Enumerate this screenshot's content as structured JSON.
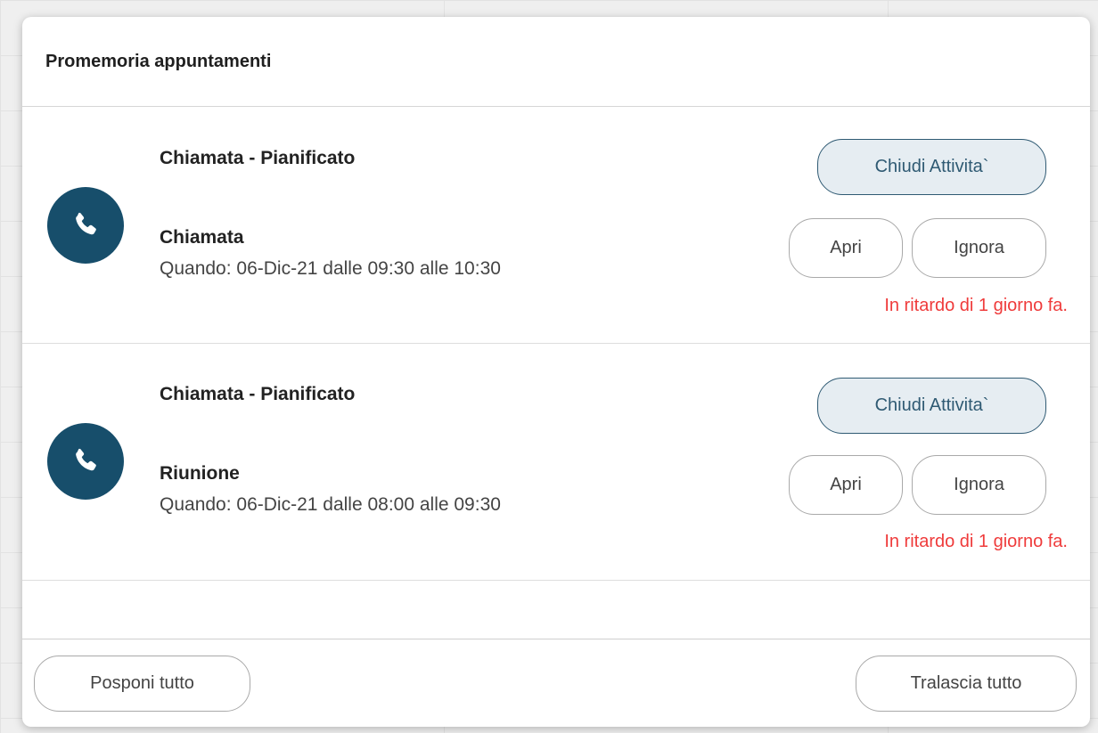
{
  "dialog": {
    "title": "Promemoria appuntamenti"
  },
  "reminders": [
    {
      "title": "Chiamata - Pianificato",
      "subject": "Chiamata",
      "when": "Quando: 06-Dic-21 dalle 09:30 alle 10:30",
      "close_label": "Chiudi Attivita`",
      "open_label": "Apri",
      "ignore_label": "Ignora",
      "status": "In ritardo di 1 giorno fa.",
      "icon": "phone-icon"
    },
    {
      "title": "Chiamata - Pianificato",
      "subject": "Riunione",
      "when": "Quando: 06-Dic-21 dalle 08:00 alle 09:30",
      "close_label": "Chiudi Attivita`",
      "open_label": "Apri",
      "ignore_label": "Ignora",
      "status": "In ritardo di 1 giorno fa.",
      "icon": "phone-icon"
    }
  ],
  "footer": {
    "snooze_all_label": "Posponi tutto",
    "dismiss_all_label": "Tralascia tutto"
  },
  "colors": {
    "avatar": "#174e6b",
    "primary_button": "#2f5a73",
    "overdue": "#ef3b3b"
  }
}
